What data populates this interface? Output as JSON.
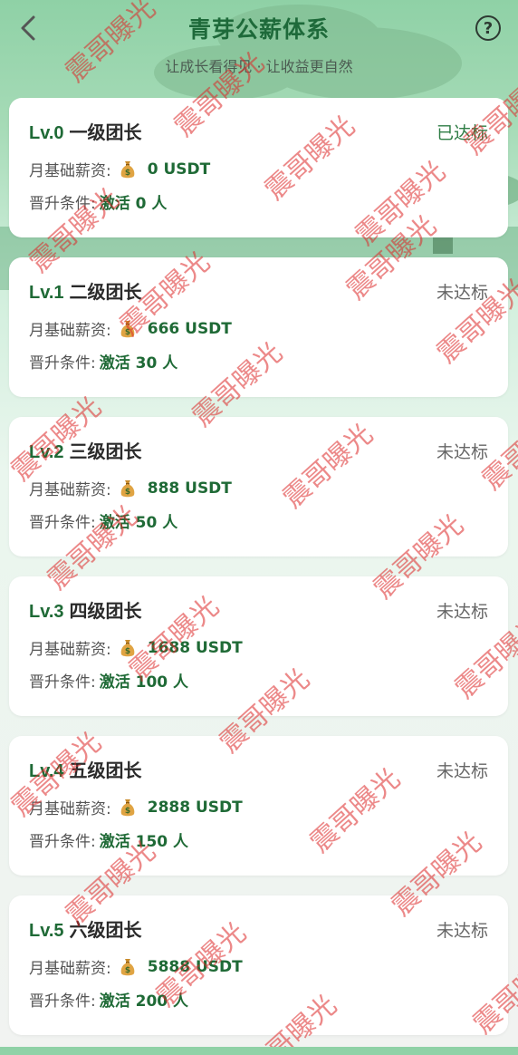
{
  "header": {
    "title": "青芽公薪体系",
    "subtitle": "让成长看得见 · 让收益更自然"
  },
  "labels": {
    "salary": "月基础薪资:",
    "condition": "晋升条件:"
  },
  "levels": [
    {
      "lv": "Lv.0",
      "name": "一级团长",
      "status": "已达标",
      "achieved": true,
      "salary": "0 USDT",
      "condition": "激活 0 人"
    },
    {
      "lv": "Lv.1",
      "name": "二级团长",
      "status": "未达标",
      "achieved": false,
      "salary": "666 USDT",
      "condition": "激活 30 人"
    },
    {
      "lv": "Lv.2",
      "name": "三级团长",
      "status": "未达标",
      "achieved": false,
      "salary": "888 USDT",
      "condition": "激活 50 人"
    },
    {
      "lv": "Lv.3",
      "name": "四级团长",
      "status": "未达标",
      "achieved": false,
      "salary": "1688 USDT",
      "condition": "激活 100 人"
    },
    {
      "lv": "Lv.4",
      "name": "五级团长",
      "status": "未达标",
      "achieved": false,
      "salary": "2888 USDT",
      "condition": "激活 150 人"
    },
    {
      "lv": "Lv.5",
      "name": "六级团长",
      "status": "未达标",
      "achieved": false,
      "salary": "5888 USDT",
      "condition": "激活 200 人"
    }
  ],
  "watermark": "震哥曝光",
  "icons": {
    "back": "chevron-left-icon",
    "help": "question-circle-icon",
    "money": "money-bag-icon"
  }
}
